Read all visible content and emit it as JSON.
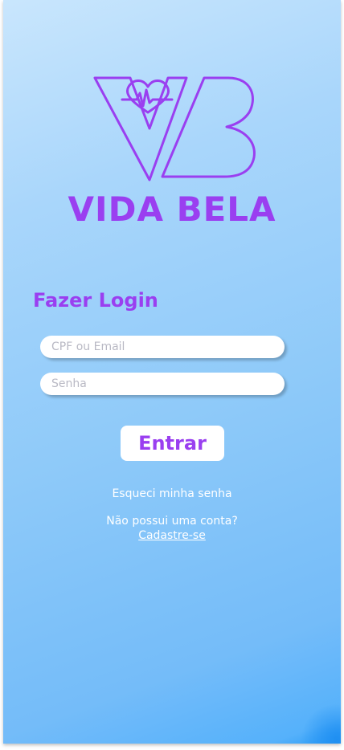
{
  "brand": {
    "name": "VIDA BELA",
    "logo_icon": "vb-heart-pulse-logo-icon",
    "accent_color": "#9a3ff0"
  },
  "login": {
    "title": "Fazer Login",
    "user_placeholder": "CPF ou Email",
    "password_placeholder": "Senha",
    "submit_label": "Entrar",
    "forgot_password": "Esqueci minha senha",
    "no_account_text": "Não possui uma conta?",
    "signup_link": "Cadastre-se"
  }
}
